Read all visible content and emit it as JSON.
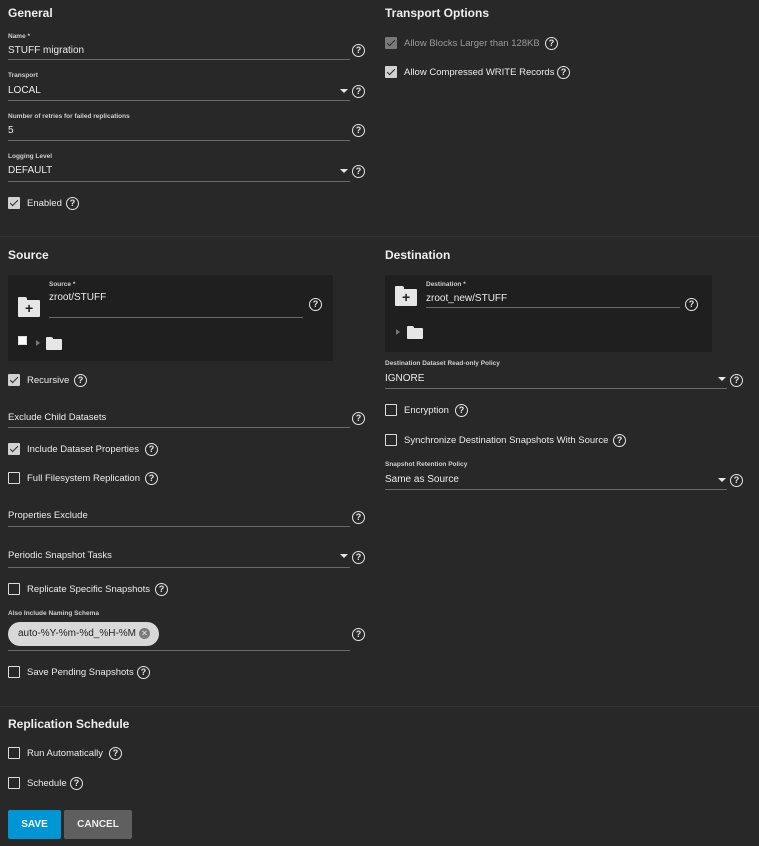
{
  "general": {
    "heading": "General",
    "name_label": "Name *",
    "name_value": "STUFF migration",
    "transport_label": "Transport",
    "transport_value": "LOCAL",
    "retries_label": "Number of retries for failed replications",
    "retries_value": "5",
    "logging_label": "Logging Level",
    "logging_value": "DEFAULT",
    "enabled_label": "Enabled"
  },
  "transport_options": {
    "heading": "Transport Options",
    "large_blocks_label": "Allow Blocks Larger than 128KB",
    "compressed_label": "Allow Compressed WRITE Records"
  },
  "source": {
    "heading": "Source",
    "field_label": "Source *",
    "field_value": "zroot/STUFF",
    "recursive_label": "Recursive",
    "exclude_child_label": "Exclude Child Datasets",
    "include_props_label": "Include Dataset Properties",
    "full_fs_label": "Full Filesystem Replication",
    "props_exclude_label": "Properties Exclude",
    "periodic_label": "Periodic Snapshot Tasks",
    "replicate_specific_label": "Replicate Specific Snapshots",
    "naming_schema_label": "Also Include Naming Schema",
    "naming_schema_chip": "auto-%Y-%m-%d_%H-%M",
    "save_pending_label": "Save Pending Snapshots"
  },
  "destination": {
    "heading": "Destination",
    "field_label": "Destination *",
    "field_value": "zroot_new/STUFF",
    "readonly_label": "Destination Dataset Read-only Policy",
    "readonly_value": "IGNORE",
    "encryption_label": "Encryption",
    "sync_label": "Synchronize Destination Snapshots With Source",
    "retention_label": "Snapshot Retention Policy",
    "retention_value": "Same as Source"
  },
  "schedule": {
    "heading": "Replication Schedule",
    "run_auto_label": "Run Automatically",
    "schedule_label": "Schedule"
  },
  "actions": {
    "save": "SAVE",
    "cancel": "CANCEL"
  },
  "icons": {
    "help": "help-circle-icon",
    "dropdown": "caret-down-icon",
    "folder_add": "folder-plus-icon",
    "folder": "folder-icon",
    "chip_remove": "close-circle-icon"
  },
  "colors": {
    "background": "#282828",
    "panel": "#1f1f1f",
    "primary": "#0095d5",
    "secondary": "#5f5f5f"
  }
}
